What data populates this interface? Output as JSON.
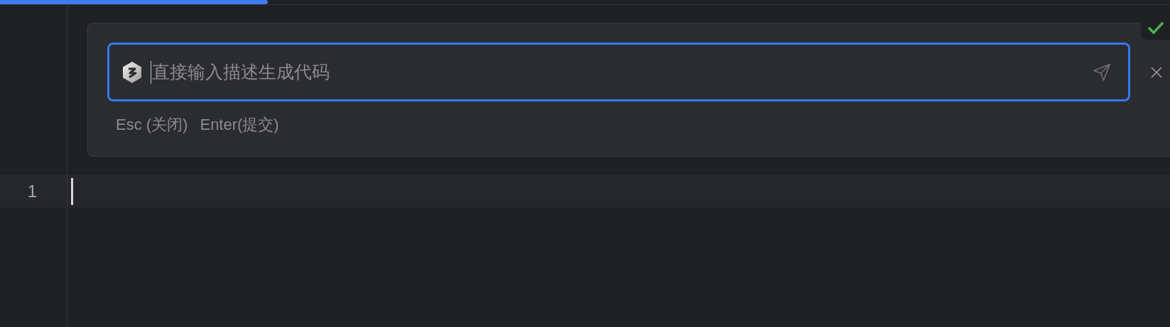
{
  "progress": {
    "level": 0.229
  },
  "prompt": {
    "placeholder": "直接输入描述生成代码",
    "hints": [
      "Esc (关闭)",
      "Enter(提交)"
    ]
  },
  "editor": {
    "lines": [
      {
        "number": "1"
      }
    ]
  }
}
